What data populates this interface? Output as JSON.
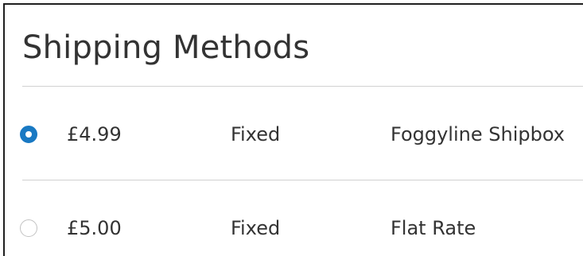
{
  "title": "Shipping Methods",
  "methods": [
    {
      "selected": true,
      "price": "£4.99",
      "method": "Fixed",
      "carrier": "Foggyline Shipbox"
    },
    {
      "selected": false,
      "price": "£5.00",
      "method": "Fixed",
      "carrier": "Flat Rate"
    }
  ],
  "colors": {
    "accent": "#1979c3",
    "text": "#333333",
    "divider": "#d1d1d1"
  }
}
